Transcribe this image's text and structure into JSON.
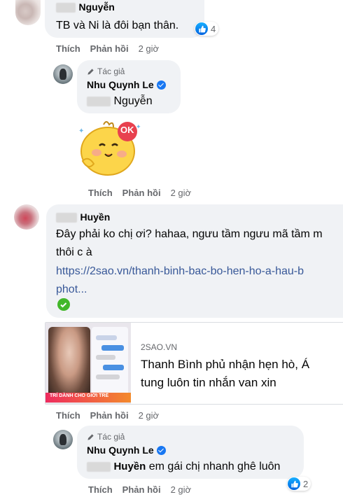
{
  "comments": [
    {
      "author_suffix": "Nguyễn",
      "text": "TB và Ni là đôi bạn thân.",
      "reactions": "4",
      "actions": {
        "like": "Thích",
        "reply": "Phản hồi",
        "time": "2 giờ"
      }
    },
    {
      "author_tag": "Tác giả",
      "author": "Nhu Quynh Le",
      "mention_suffix": "Nguyễn",
      "sticker_text": "OK",
      "actions": {
        "like": "Thích",
        "reply": "Phản hồi",
        "time": "2 giờ"
      }
    },
    {
      "author_suffix": "Huyền",
      "text": "Đây phải ko chị ơi? hahaa, ngưu tầm ngưu mã tầm m",
      "text_line2": "thôi c à",
      "link_line1": "https://2sao.vn/thanh-binh-bac-bo-hen-ho-a-hau-b",
      "link_line2": "phot...",
      "preview": {
        "domain": "2SAO.VN",
        "title_line1": "Thanh Bình phủ nhận hẹn hò, Á",
        "title_line2": "tung luôn tin nhắn van xin",
        "thumb_caption": "TRÍ DÀNH CHO GIỚI TRẺ"
      },
      "actions": {
        "like": "Thích",
        "reply": "Phản hồi",
        "time": "2 giờ"
      }
    },
    {
      "author_tag": "Tác giả",
      "author": "Nhu Quynh Le",
      "mention_suffix": "Huyền",
      "text": "em gái chị nhanh ghê luôn",
      "reactions": "2",
      "actions": {
        "like": "Thích",
        "reply": "Phản hồi",
        "time": "2 giờ"
      }
    }
  ],
  "colors": {
    "like_blue": "#1877f2",
    "link": "#385898",
    "bubble": "#f0f2f5",
    "meta": "#65676b"
  }
}
